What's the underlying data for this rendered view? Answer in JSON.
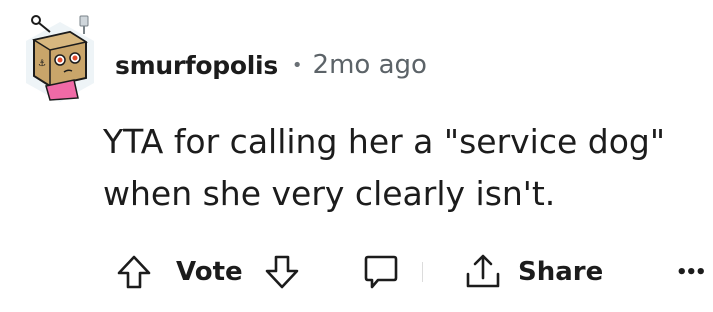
{
  "comment": {
    "author": "smurfopolis",
    "separator": "•",
    "age": "2mo ago",
    "body_lines": [
      "YTA for calling her a \"service dog\"",
      "when she very clearly isn't."
    ]
  },
  "actions": {
    "vote_label": "Vote",
    "share_label": "Share",
    "more_label": "•••"
  },
  "colors": {
    "text": "#1c1c1c",
    "meta": "#5c6368",
    "avatar_box": "#c9a56a",
    "avatar_bg": "#eef4f7"
  },
  "icons": {
    "upvote": "upvote-arrow-icon",
    "downvote": "downvote-arrow-icon",
    "reply": "comment-bubble-icon",
    "share": "share-icon",
    "more": "more-options-icon"
  }
}
